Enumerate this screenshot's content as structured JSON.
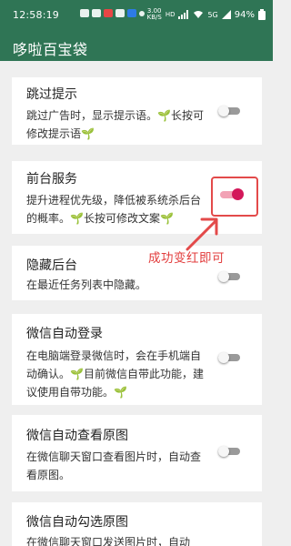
{
  "status_bar": {
    "time": "12:58:19",
    "net_speed_value": "3.00",
    "net_speed_unit": "KB/S",
    "hd": "HD",
    "signal": "5G",
    "battery": "94%"
  },
  "app": {
    "title": "哆啦百宝袋",
    "bar_color": "#2f7555"
  },
  "settings": [
    {
      "title": "跳过提示",
      "description": "跳过广告时，显示提示语。🌱长按可修改提示语🌱",
      "enabled": false
    },
    {
      "title": "前台服务",
      "description": "提升进程优先级，降低被系统杀后台的概率。🌱长按可修改文案🌱",
      "enabled": true
    },
    {
      "title": "隐藏后台",
      "description": "在最近任务列表中隐藏。",
      "enabled": false
    },
    {
      "title": "微信自动登录",
      "description": "在电脑端登录微信时，会在手机端自动确认。🌱目前微信自带此功能，建议使用自带功能。🌱",
      "enabled": false
    },
    {
      "title": "微信自动查看原图",
      "description": "在微信聊天窗口查看图片时，自动查看原图。",
      "enabled": false
    },
    {
      "title": "微信自动勾选原图",
      "description": "在微信聊天窗口发送图片时，自动",
      "enabled": false
    }
  ],
  "annotation": {
    "text": "成功变红即可",
    "color": "#e23c3c"
  }
}
